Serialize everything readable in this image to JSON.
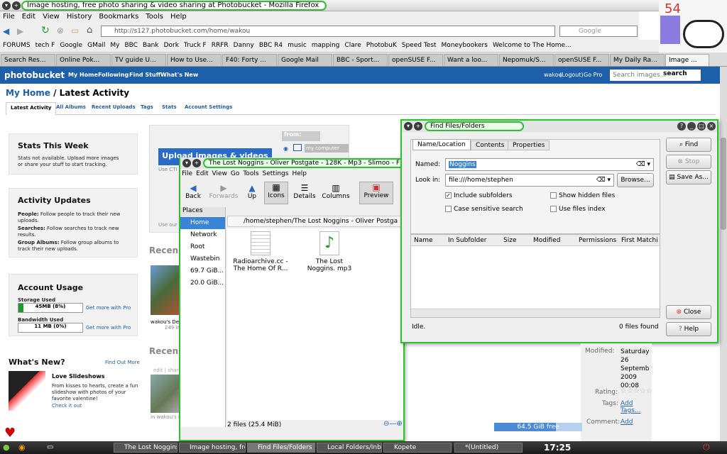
{
  "firefox": {
    "title": "Image hosting, free photo sharing & video sharing at Photobucket - Mozilla Firefox",
    "menu": [
      "File",
      "Edit",
      "View",
      "History",
      "Bookmarks",
      "Tools",
      "Help"
    ],
    "url": "http://s127.photobucket.com/home/wakou",
    "search_placeholder": "Google",
    "bookmarks": [
      "FORUMS",
      "tech F",
      "Google",
      "GMail",
      "My",
      "BBC",
      "Bank",
      "Dork",
      "Truck F",
      "RRFR",
      "Danny",
      "BBC R4",
      "music",
      "mapping",
      "Clare",
      "PhotobuK",
      "Speed Test",
      "Moneybookers",
      "Welcome to The Home..."
    ],
    "tabs": [
      "Search Res...",
      "Online Pok...",
      "TV guide U...",
      "How to Use...",
      "F40: Forty ...",
      "Google Mail",
      "BBC - Sport...",
      "openSUSE F...",
      "Want a loo...",
      "Nepomuk/S...",
      "openSUSE F...",
      "My Daily Ra...",
      "Image ..."
    ]
  },
  "overlay_counter": "54",
  "photobucket": {
    "logo": "photobucket",
    "nav": [
      "My Home",
      "Following",
      "Find Stuff",
      "What's New"
    ],
    "user": "wakou",
    "logout": "(Logout)",
    "gopro": "Go Pro",
    "search_placeholder": "Search images...",
    "search_btn": "search",
    "breadcrumb_home": "My Home",
    "breadcrumb_sep": "/",
    "breadcrumb_page": "Latest Activity",
    "subtabs": [
      "Latest Activity",
      "All Albums",
      "Recent Uploads",
      "Tags",
      "Stats",
      "Account Settings"
    ],
    "stats_title": "Stats This Week",
    "stats_text": "Stats not available. Upload more images or share your stuff to start tracking.",
    "activity_title": "Activity Updates",
    "activity": [
      {
        "k": "People:",
        "v": "Follow people to track their new uploads."
      },
      {
        "k": "Searches:",
        "v": "Follow searches to track new results."
      },
      {
        "k": "Group Albums:",
        "v": "Follow group albums to track their new uploads."
      }
    ],
    "usage_title": "Account Usage",
    "storage_label": "Storage Used",
    "storage_value": "45MB (8%)",
    "storage_fill": 0.08,
    "bandwidth_label": "Bandwidth Used",
    "bandwidth_value": "11 MB (0%)",
    "bandwidth_fill": 0.0,
    "get_more": "Get more with Pro",
    "whatsnew_title": "What's New?",
    "find_out_more": "Find Out More",
    "love_title": "Love Slideshows",
    "love_text": "From kisses to hearts, create a fun slideshow with photos of your favorite valentine!",
    "check_it_out": "Check it out",
    "upload_btn": "Upload images & videos",
    "from_label": "from:",
    "from_value": "my computer",
    "use_ctrl": "Use CTI",
    "use_our": "Use our",
    "recent_label": "Recen",
    "wakou_caption": "wakou's De",
    "caption_num": "249 Ir",
    "edit_share": "edit | share",
    "wakou_caption2": "in wakou's B"
  },
  "file_manager": {
    "title": "The Lost Noggins - Oliver Postgate - 128K - Mp3 - Slimoo - F",
    "menu": [
      "File",
      "Edit",
      "View",
      "Go",
      "Tools",
      "Settings",
      "Help"
    ],
    "toolbar": [
      "Back",
      "Forwards",
      "Up",
      "Icons",
      "Details",
      "Columns",
      "Preview"
    ],
    "places_label": "Places",
    "places": [
      "Home",
      "Network",
      "Root",
      "Wastebin",
      "69.7 GiB...",
      "20.0 GiB..."
    ],
    "path": "/home/stephen/The Lost Noggins - Oliver Postga",
    "files": [
      {
        "name": "Radioarchive.cc - The Home Of R...",
        "type": "text"
      },
      {
        "name": "The Lost Noggins. mp3",
        "type": "audio"
      }
    ],
    "status": "2 files (25.4 MiB)",
    "free": "64.5 GiB free"
  },
  "find_dialog": {
    "title": "Find Files/Folders",
    "tabs": [
      "Name/Location",
      "Contents",
      "Properties"
    ],
    "named_label": "Named:",
    "named_value": "Noggins",
    "lookin_label": "Look in:",
    "lookin_value": "file:///home/stephen",
    "browse": "Browse...",
    "include_sub": "Include subfolders",
    "case_sens": "Case sensitive search",
    "show_hidden": "Show hidden files",
    "use_index": "Use files index",
    "columns": [
      "Name",
      "In Subfolder",
      "Size",
      "Modified",
      "Permissions",
      "First Matchi"
    ],
    "status_left": "Idle.",
    "status_right": "0 files found",
    "buttons": {
      "find": "Find",
      "stop": "Stop",
      "save": "Save As...",
      "close": "Close",
      "help": "Help"
    }
  },
  "properties_peek": {
    "modified_label": "Modified:",
    "modified_value": "Saturday 26 Septemb 2009 00:08",
    "rating_label": "Rating:",
    "tags_label": "Tags:",
    "tags_link": "Add Tags...",
    "comment_label": "Comment:",
    "comment_link": "Add"
  },
  "taskbar": {
    "tasks": [
      "The Lost Noggins",
      "Image hosting, fre",
      "Find Files/Folders",
      "Local Folders/Inb",
      "Kopete",
      "*(Untitled)"
    ],
    "clock": "17:25"
  }
}
